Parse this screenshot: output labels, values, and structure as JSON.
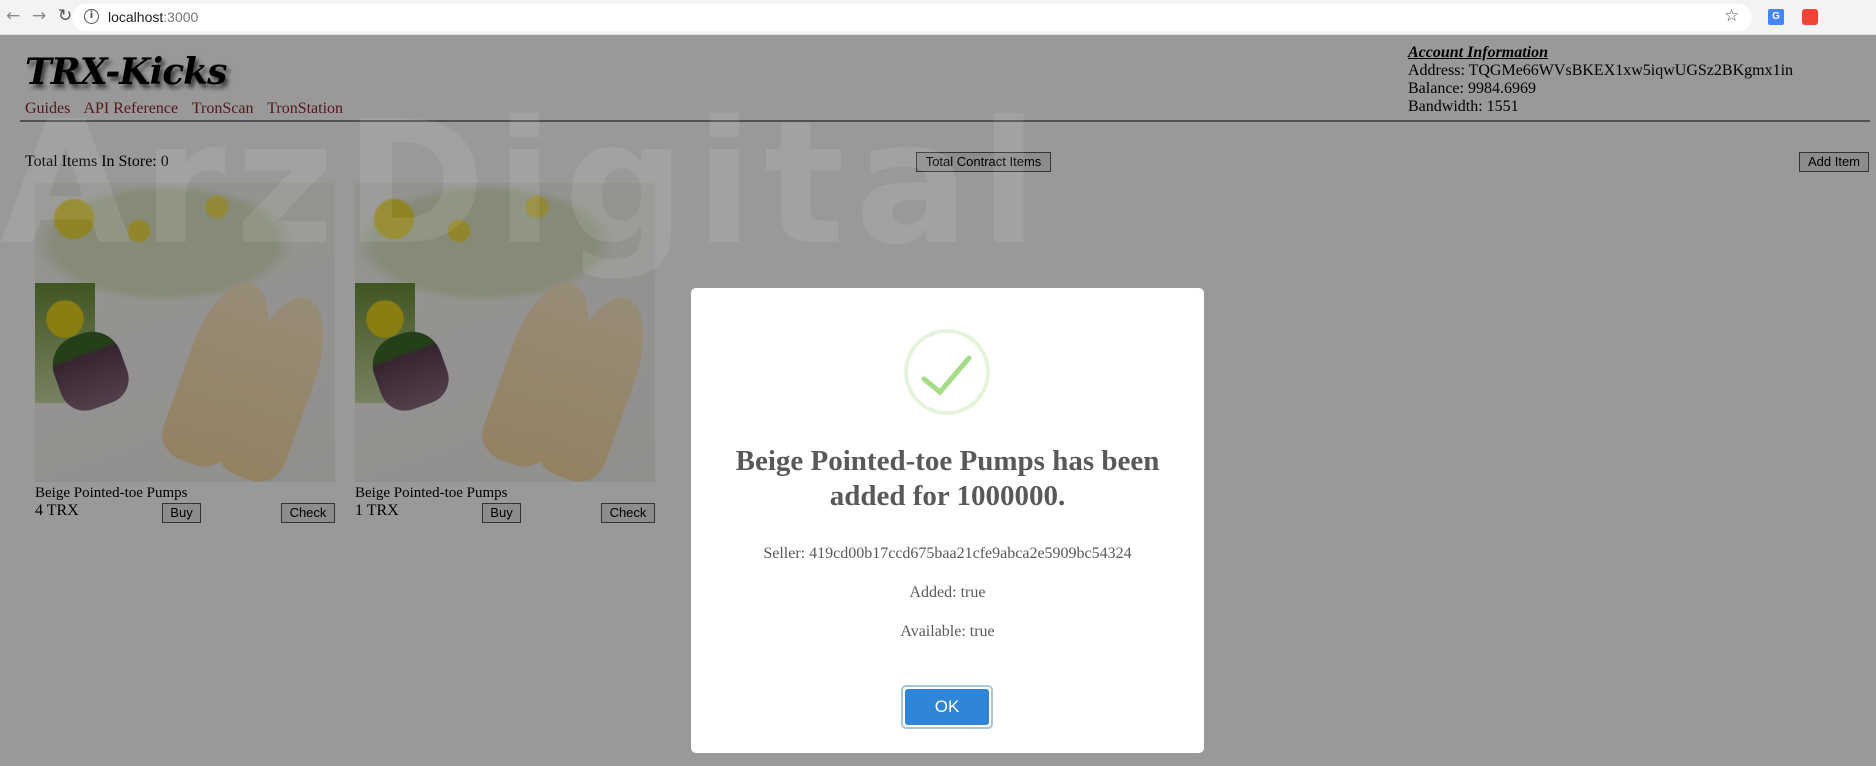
{
  "browser": {
    "url_host": "localhost",
    "url_port": ":3000",
    "back_icon": "arrow-left",
    "forward_icon": "arrow-right",
    "reload_icon": "reload",
    "bookmark_icon": "star"
  },
  "header": {
    "logo": "TRX-Kicks",
    "links": [
      "Guides",
      "API Reference",
      "TronScan",
      "TronStation"
    ]
  },
  "account": {
    "heading": "Account Information",
    "address": "Address: TQGMe66WVsBKEX1xw5iqwUGSz2BKgmx1in",
    "balance": "Balance: 9984.6969",
    "bandwidth": "Bandwidth: 1551"
  },
  "store": {
    "total_items": "Total Items In Store: 0",
    "total_contract_button": "Total Contract Items",
    "add_item_button": "Add Item"
  },
  "items": [
    {
      "name": "Beige Pointed-toe Pumps",
      "price": "4 TRX",
      "buy": "Buy",
      "check": "Check"
    },
    {
      "name": "Beige Pointed-toe Pumps",
      "price": "1 TRX",
      "buy": "Buy",
      "check": "Check"
    }
  ],
  "watermark": "ArzDigital",
  "modal": {
    "icon": "success-check",
    "title": "Beige Pointed-toe Pumps has been added for 1000000.",
    "seller": "Seller: 419cd00b17ccd675baa21cfe9abca2e5909bc54324",
    "added": "Added: true",
    "available": "Available: true",
    "ok": "OK",
    "colors": {
      "success": "#a5dc86",
      "confirm": "#3085d6"
    }
  }
}
